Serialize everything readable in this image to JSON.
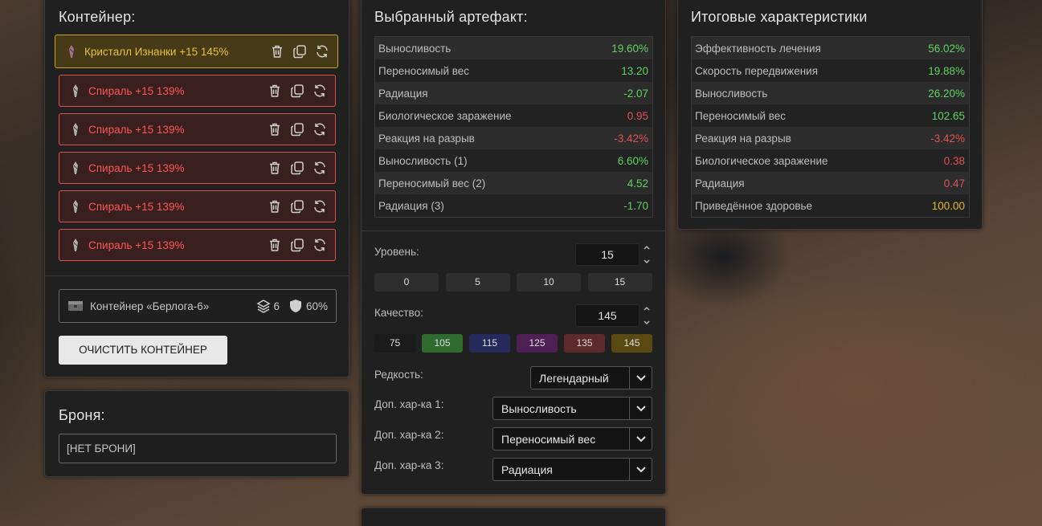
{
  "container_panel": {
    "title": "Контейнер:",
    "items": [
      {
        "label": "Кристалл Изнанки +15 145%",
        "rarity": "legendary"
      },
      {
        "label": "Спираль +15 139%",
        "rarity": "exceptional"
      },
      {
        "label": "Спираль +15 139%",
        "rarity": "exceptional"
      },
      {
        "label": "Спираль +15 139%",
        "rarity": "exceptional"
      },
      {
        "label": "Спираль +15 139%",
        "rarity": "exceptional"
      },
      {
        "label": "Спираль +15 139%",
        "rarity": "exceptional"
      }
    ],
    "container_name": "Контейнер «Берлога-6»",
    "slots": "6",
    "protection": "60%",
    "clear_button": "ОЧИСТИТЬ КОНТЕЙНЕР"
  },
  "armor_panel": {
    "title": "Броня:",
    "value": "[НЕТ БРОНИ]"
  },
  "selected_panel": {
    "title": "Выбранный артефакт:",
    "stats": [
      {
        "name": "Выносливость",
        "value": "19.60%",
        "color": "green"
      },
      {
        "name": "Переносимый вес",
        "value": "13.20",
        "color": "green"
      },
      {
        "name": "Радиация",
        "value": "-2.07",
        "color": "green"
      },
      {
        "name": "Биологическое заражение",
        "value": "0.95",
        "color": "red"
      },
      {
        "name": "Реакция на разрыв",
        "value": "-3.42%",
        "color": "red"
      },
      {
        "name": "Выносливость (1)",
        "value": "6.60%",
        "color": "green"
      },
      {
        "name": "Переносимый вес (2)",
        "value": "4.52",
        "color": "green"
      },
      {
        "name": "Радиация (3)",
        "value": "-1.70",
        "color": "green"
      }
    ],
    "level_label": "Уровень:",
    "level_value": "15",
    "level_presets": [
      "0",
      "5",
      "10",
      "15"
    ],
    "quality_label": "Качество:",
    "quality_value": "145",
    "quality_presets": [
      {
        "label": "75",
        "color": "#1b1b1b"
      },
      {
        "label": "105",
        "color": "#2f6a2f"
      },
      {
        "label": "115",
        "color": "#252a5c"
      },
      {
        "label": "125",
        "color": "#4e1f52"
      },
      {
        "label": "135",
        "color": "#5c2a2a"
      },
      {
        "label": "145",
        "color": "#5a4a12"
      }
    ],
    "rarity_label": "Редкость:",
    "rarity_value": "Легендарный",
    "extra1_label": "Доп. хар-ка 1:",
    "extra1_value": "Выносливость",
    "extra2_label": "Доп. хар-ка 2:",
    "extra2_value": "Переносимый вес",
    "extra3_label": "Доп. хар-ка 3:",
    "extra3_value": "Радиация"
  },
  "totals_panel": {
    "title": "Итоговые характеристики",
    "stats": [
      {
        "name": "Эффективность лечения",
        "value": "56.02%",
        "color": "green"
      },
      {
        "name": "Скорость передвижения",
        "value": "19.88%",
        "color": "green"
      },
      {
        "name": "Выносливость",
        "value": "26.20%",
        "color": "green"
      },
      {
        "name": "Переносимый вес",
        "value": "102.65",
        "color": "green"
      },
      {
        "name": "Реакция на разрыв",
        "value": "-3.42%",
        "color": "red"
      },
      {
        "name": "Биологическое заражение",
        "value": "0.38",
        "color": "red"
      },
      {
        "name": "Радиация",
        "value": "0.47",
        "color": "red"
      },
      {
        "name": "Приведённое здоровье",
        "value": "100.00",
        "color": "yellow"
      }
    ]
  }
}
